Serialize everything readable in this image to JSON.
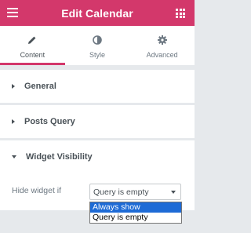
{
  "header": {
    "title": "Edit Calendar",
    "menu_icon": "hamburger-menu-icon",
    "grid_icon": "apps-grid-icon",
    "color": "#d3386b"
  },
  "tabs": [
    {
      "label": "Content",
      "icon": "pencil-icon",
      "active": true
    },
    {
      "label": "Style",
      "icon": "contrast-icon",
      "active": false
    },
    {
      "label": "Advanced",
      "icon": "gear-icon",
      "active": false
    }
  ],
  "sections": {
    "general": {
      "label": "General",
      "expanded": false
    },
    "posts_query": {
      "label": "Posts Query",
      "expanded": false
    },
    "widget_visibility": {
      "label": "Widget Visibility",
      "expanded": true
    }
  },
  "control": {
    "label": "Hide widget if",
    "value": "Query is empty",
    "options": [
      "Always show",
      "Query is empty"
    ],
    "highlighted_option": "Always show"
  }
}
